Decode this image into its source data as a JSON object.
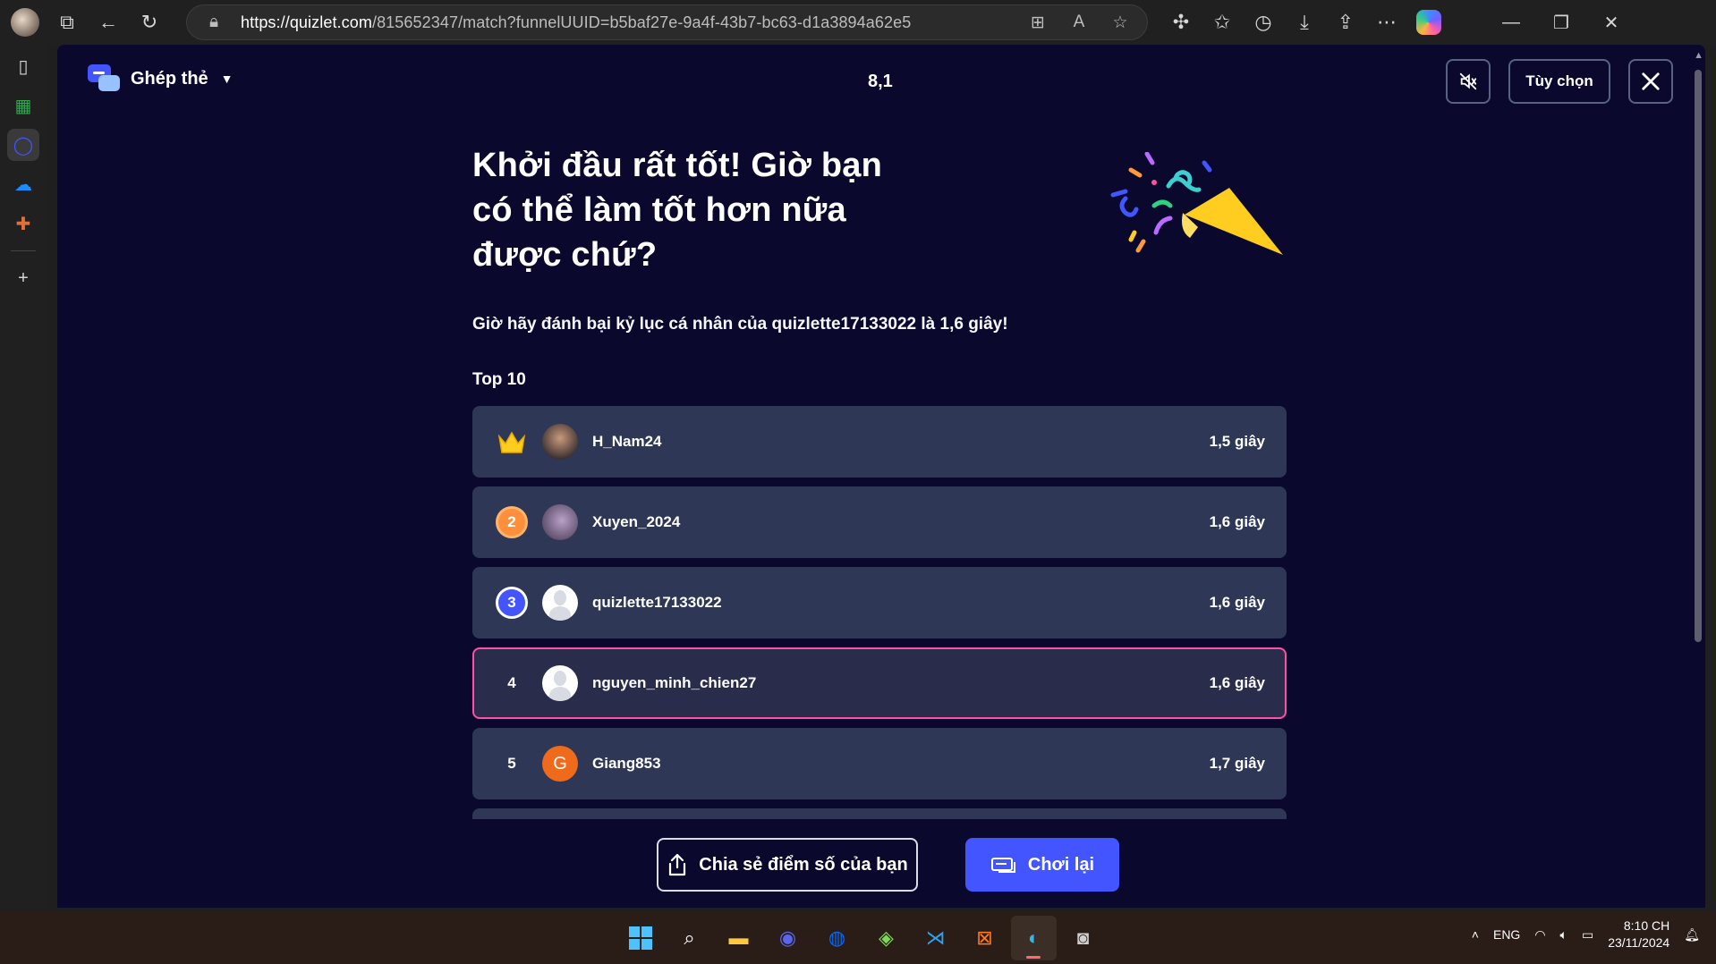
{
  "browser": {
    "url_domain": "https://quizlet.com",
    "url_rest": "/815652347/match?funnelUUID=b5baf27e-9a4f-43b7-bc63-d1a3894a62e5"
  },
  "header": {
    "mode_label": "Ghép thẻ",
    "timer": "8,1",
    "options_label": "Tùy chọn"
  },
  "result": {
    "headline": "Khởi đầu rất tốt! Giờ bạn có thể làm tốt hơn nữa được chứ?",
    "sub_prefix": "Giờ hãy đánh bại kỷ lục cá nhân của ",
    "sub_user": "quizlette17133022",
    "sub_middle": " là ",
    "sub_time": "1,6 giây",
    "sub_suffix": "!",
    "top_label": "Top 10"
  },
  "leaderboard": [
    {
      "rank": "1",
      "name": "H_Nam24",
      "time": "1,5 giây"
    },
    {
      "rank": "2",
      "name": "Xuyen_2024",
      "time": "1,6 giây"
    },
    {
      "rank": "3",
      "name": "quizlette17133022",
      "time": "1,6 giây"
    },
    {
      "rank": "4",
      "name": "nguyen_minh_chien27",
      "time": "1,6 giây"
    },
    {
      "rank": "5",
      "name": "Giang853",
      "time": "1,7 giây",
      "avatar_letter": "G"
    }
  ],
  "actions": {
    "share_label": "Chia sẻ điểm số của bạn",
    "replay_label": "Chơi lại"
  },
  "taskbar": {
    "lang": "ENG",
    "time": "8:10 CH",
    "date": "23/11/2024"
  },
  "colors": {
    "page_bg": "#0a092d",
    "row_bg": "#2e3856",
    "accent": "#4255ff",
    "highlight_border": "#ff4fa8"
  }
}
